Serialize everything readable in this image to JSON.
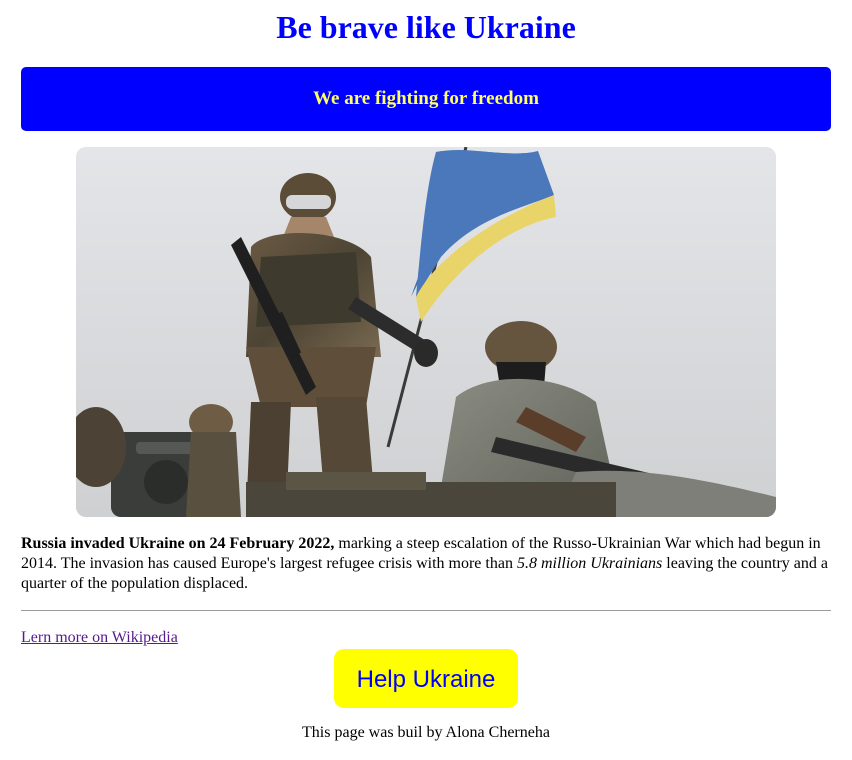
{
  "header": {
    "title": "Be brave like Ukraine"
  },
  "banner": {
    "text": "We are fighting for freedom"
  },
  "hero_image": {
    "icon": "soldiers-with-ukrainian-flag-photo"
  },
  "article": {
    "bold_lead": "Russia invaded Ukraine on 24 February 2022,",
    "part1": " marking a steep escalation of the Russo-Ukrainian War which had begun in 2014. The invasion has caused Europe's largest refugee crisis with more than ",
    "italic": "5.8 million Ukrainians",
    "part2": " leaving the country and a quarter of the population displaced."
  },
  "links": {
    "wikipedia": "Lern more on Wikipedia"
  },
  "cta": {
    "label": "Help Ukraine"
  },
  "footer": {
    "text": "This page was buil by Alona Cherneha"
  },
  "colors": {
    "title": "#0000ee",
    "banner_bg": "#0000ff",
    "banner_text": "#ffff66",
    "button_bg": "#ffff00",
    "button_text": "#0000ff",
    "link_visited": "#551a8b",
    "flag_blue": "#3d6fb5",
    "flag_yellow": "#e9d46a"
  }
}
